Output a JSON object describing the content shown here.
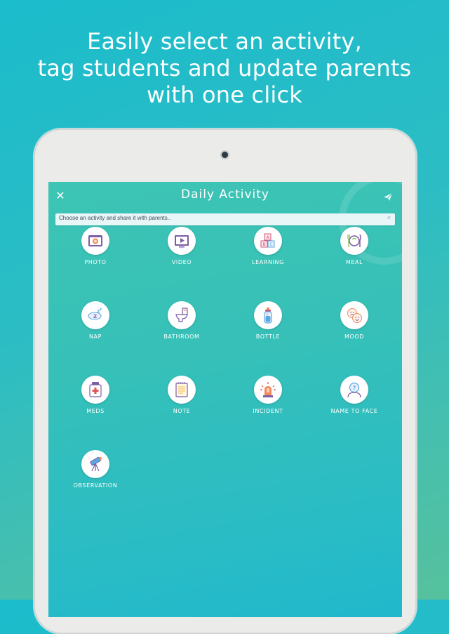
{
  "headline": {
    "line1": "Easily select an activity,",
    "line2": "tag students and update parents",
    "line3": "with one click"
  },
  "app": {
    "title": "Daily Activity",
    "close_icon": "close-icon",
    "send_icon": "send-icon",
    "banner": {
      "text": "Choose an activity and share it with parents..",
      "close_glyph": "×"
    }
  },
  "activities": [
    {
      "label": "PHOTO",
      "icon": "photo-icon"
    },
    {
      "label": "VIDEO",
      "icon": "video-icon"
    },
    {
      "label": "LEARNING",
      "icon": "learning-icon"
    },
    {
      "label": "MEAL",
      "icon": "meal-icon"
    },
    {
      "label": "NAP",
      "icon": "nap-icon"
    },
    {
      "label": "BATHROOM",
      "icon": "bathroom-icon"
    },
    {
      "label": "BOTTLE",
      "icon": "bottle-icon"
    },
    {
      "label": "MOOD",
      "icon": "mood-icon"
    },
    {
      "label": "MEDS",
      "icon": "meds-icon"
    },
    {
      "label": "NOTE",
      "icon": "note-icon"
    },
    {
      "label": "INCIDENT",
      "icon": "incident-icon"
    },
    {
      "label": "NAME TO FACE",
      "icon": "name-to-face-icon"
    },
    {
      "label": "OBSERVATION",
      "icon": "observation-icon"
    }
  ],
  "colors": {
    "accent_purple": "#7b5ea7",
    "icon_orange": "#f28a5b",
    "icon_blue": "#5aa8e0",
    "icon_green": "#8cc152"
  }
}
